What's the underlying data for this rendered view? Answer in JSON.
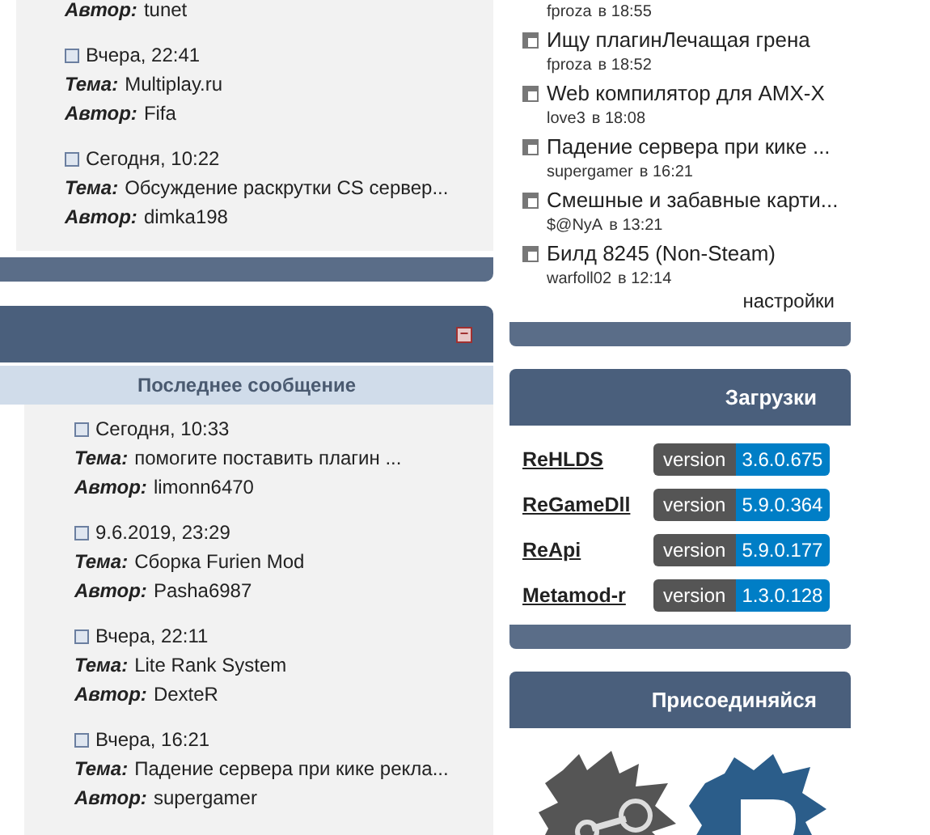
{
  "latest_posts_top": {
    "posts": [
      {
        "author_label": "Автор:",
        "author": "tunet"
      },
      {
        "date": "Вчера, 22:41",
        "topic_label": "Тема:",
        "topic": "Multiplay.ru",
        "author_label": "Автор:",
        "author": "Fifa"
      },
      {
        "date": "Сегодня, 10:22",
        "topic_label": "Тема:",
        "topic": "Обсуждение раскрутки CS сервер...",
        "author_label": "Автор:",
        "author": "dimka198"
      }
    ]
  },
  "forum_panel": {
    "collapse_icon": "−",
    "column_heading": "Последнее сообщение",
    "posts": [
      {
        "date": "Сегодня, 10:33",
        "topic_label": "Тема:",
        "topic": "помогите поставить плагин ...",
        "author_label": "Автор:",
        "author": "limonn6470"
      },
      {
        "date": "9.6.2019, 23:29",
        "topic_label": "Тема:",
        "topic": "Сборка Furien Mod",
        "author_label": "Автор:",
        "author": "Pasha6987"
      },
      {
        "date": "Вчера, 22:11",
        "topic_label": "Тема:",
        "topic": "Lite Rank System",
        "author_label": "Автор:",
        "author": "DexteR"
      },
      {
        "date": "Вчера, 16:21",
        "topic_label": "Тема:",
        "topic": "Падение сервера при кике рекла...",
        "author_label": "Автор:",
        "author": "supergamer"
      }
    ]
  },
  "recent_topics": {
    "items": [
      {
        "user": "fproza",
        "time": "в 18:55"
      },
      {
        "title": "Ищу плагинЛечащая грена",
        "user": "fproza",
        "time": "в 18:52"
      },
      {
        "title": "Web компилятор для AMX-X",
        "user": "love3",
        "time": "в 18:08"
      },
      {
        "title": "Падение сервера при кике ...",
        "user": "supergamer",
        "time": "в 16:21"
      },
      {
        "title": "Смешные и забавные карти...",
        "user": "$@NyA",
        "time": "в 13:21"
      },
      {
        "title": "Билд 8245 (Non-Steam)",
        "user": "warfoll02",
        "time": "в 12:14"
      }
    ],
    "settings_link": "настройки"
  },
  "downloads": {
    "title": "Загрузки",
    "items": [
      {
        "name": "ReHLDS",
        "label": "version",
        "version": "3.6.0.675"
      },
      {
        "name": "ReGameDll",
        "label": "version",
        "version": "5.9.0.364"
      },
      {
        "name": "ReApi",
        "label": "version",
        "version": "5.9.0.177"
      },
      {
        "name": "Metamod-r",
        "label": "version",
        "version": "1.3.0.128"
      }
    ]
  },
  "join": {
    "title": "Присоединяйся"
  }
}
